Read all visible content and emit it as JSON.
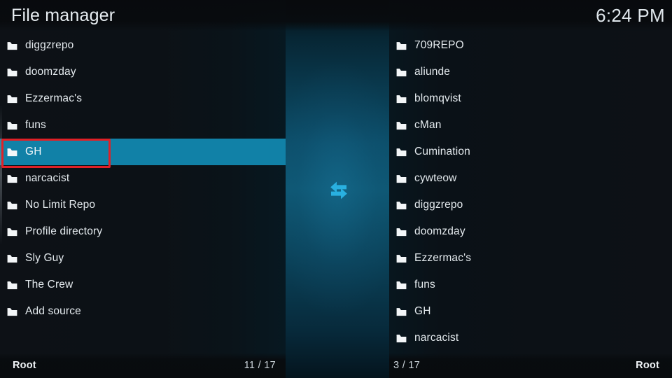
{
  "header": {
    "title": "File manager",
    "clock": "6:24 PM"
  },
  "icons": {
    "folder": "folder-icon",
    "transfer": "transfer-arrows-icon"
  },
  "colors": {
    "selection": "#1181a7",
    "annotation": "#e02026",
    "transfer_arrow": "#29b0e0",
    "text": "#e4eaee",
    "background": "#0c1014"
  },
  "left_panel": {
    "status_path": "Root",
    "status_count": "11 / 17",
    "selected_index": 4,
    "items": [
      {
        "label": "diggzrepo"
      },
      {
        "label": "doomzday"
      },
      {
        "label": "Ezzermac's"
      },
      {
        "label": "funs"
      },
      {
        "label": "GH"
      },
      {
        "label": "narcacist"
      },
      {
        "label": "No Limit Repo"
      },
      {
        "label": "Profile directory"
      },
      {
        "label": "Sly Guy"
      },
      {
        "label": "The Crew"
      },
      {
        "label": "Add source"
      }
    ]
  },
  "right_panel": {
    "status_path": "Root",
    "status_count": "3 / 17",
    "selected_index": -1,
    "items": [
      {
        "label": "709REPO"
      },
      {
        "label": "aliunde"
      },
      {
        "label": "blomqvist"
      },
      {
        "label": "cMan"
      },
      {
        "label": "Cumination"
      },
      {
        "label": "cywteow"
      },
      {
        "label": "diggzrepo"
      },
      {
        "label": "doomzday"
      },
      {
        "label": "Ezzermac's"
      },
      {
        "label": "funs"
      },
      {
        "label": "GH"
      },
      {
        "label": "narcacist"
      }
    ]
  }
}
